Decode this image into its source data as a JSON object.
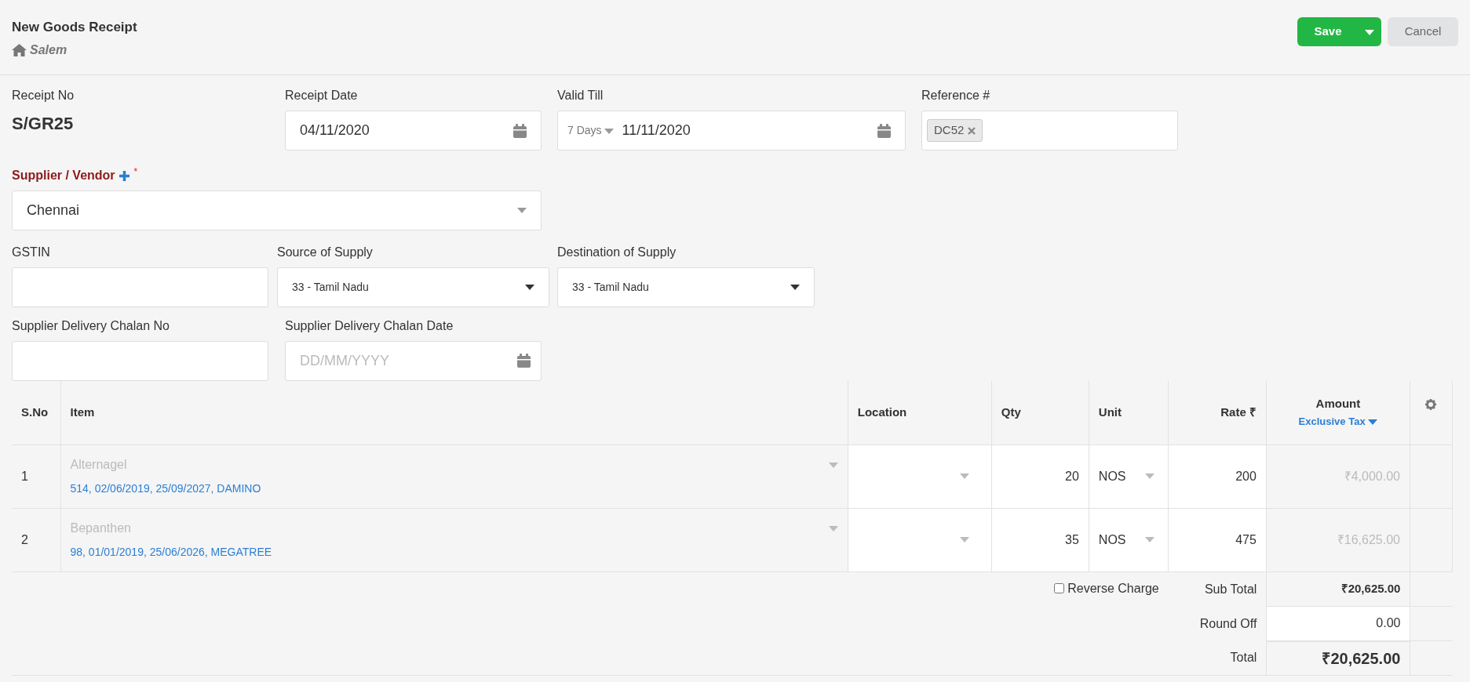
{
  "header": {
    "title": "New Goods Receipt",
    "branch": "Salem",
    "save_label": "Save",
    "cancel_label": "Cancel"
  },
  "receipt_no": {
    "label": "Receipt No",
    "value": "S/GR25"
  },
  "receipt_date": {
    "label": "Receipt Date",
    "value": "04/11/2020"
  },
  "valid_till": {
    "label": "Valid Till",
    "period": "7 Days",
    "value": "11/11/2020"
  },
  "reference": {
    "label": "Reference #",
    "tags": [
      "DC52"
    ]
  },
  "supplier": {
    "label": "Supplier / Vendor",
    "required_mark": "*",
    "value": "Chennai"
  },
  "gstin": {
    "label": "GSTIN"
  },
  "source_of_supply": {
    "label": "Source of Supply",
    "value": "33 - Tamil Nadu"
  },
  "destination_of_supply": {
    "label": "Destination of Supply",
    "value": "33 - Tamil Nadu"
  },
  "chalan_no": {
    "label": "Supplier Delivery Chalan No"
  },
  "chalan_date": {
    "label": "Supplier Delivery Chalan Date",
    "placeholder": "DD/MM/YYYY"
  },
  "table": {
    "columns": [
      "S.No",
      "Item",
      "Location",
      "Qty",
      "Unit",
      "Rate ₹",
      "Amount"
    ],
    "tax_mode": "Exclusive Tax",
    "rows": [
      {
        "sno": "1",
        "item": "Alternagel",
        "batch": "514, 02/06/2019, 25/09/2027, DAMINO",
        "qty": "20",
        "unit": "NOS",
        "rate": "200",
        "amount": "₹4,000.00"
      },
      {
        "sno": "2",
        "item": "Bepanthen",
        "batch": "98, 01/01/2019, 25/06/2026, MEGATREE",
        "qty": "35",
        "unit": "NOS",
        "rate": "475",
        "amount": "₹16,625.00"
      }
    ]
  },
  "totals": {
    "reverse_charge": {
      "label": "Reverse Charge",
      "checked": false
    },
    "sub_total_label": "Sub Total",
    "sub_total": "₹20,625.00",
    "round_off_label": "Round Off",
    "round_off": "0.00",
    "total_label": "Total",
    "total": "₹20,625.00"
  }
}
